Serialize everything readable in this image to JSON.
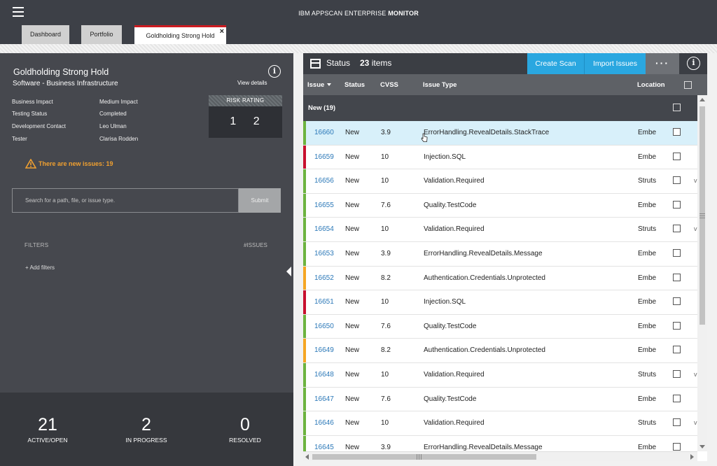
{
  "header": {
    "app_title_prefix": "IBM APPSCAN ENTERPRISE",
    "app_title_suffix": "MONITOR",
    "tabs": [
      {
        "label": "Dashboard"
      },
      {
        "label": "Portfolio"
      },
      {
        "label": "Goldholding Strong Hold",
        "close": "×"
      }
    ]
  },
  "app": {
    "name": "Goldholding Strong Hold",
    "subtitle": "Software - Business Infrastructure",
    "view_details": "View details",
    "properties": [
      {
        "key": "Business Impact",
        "value": "Medium Impact"
      },
      {
        "key": "Testing Status",
        "value": "Completed"
      },
      {
        "key": "Development Contact",
        "value": "Leo Ulman"
      },
      {
        "key": "Tester",
        "value": "Clarisa Rodden"
      }
    ],
    "risk_label": "RISK RATING",
    "risk_value": "1 2",
    "warning": "There are new issues: 19"
  },
  "search": {
    "placeholder": "Search for a path, file, or issue type.",
    "submit_label": "Submit"
  },
  "filters": {
    "heading": "FILTERS",
    "issues_heading": "#ISSUES",
    "add_label": "+ Add filters"
  },
  "stats": [
    {
      "value": "21",
      "label": "ACTIVE/OPEN"
    },
    {
      "value": "2",
      "label": "IN PROGRESS"
    },
    {
      "value": "0",
      "label": "RESOLVED"
    }
  ],
  "status_panel": {
    "title": "Status",
    "count": "23",
    "count_suffix": "items",
    "create_label": "Create Scan",
    "import_label": "Import Issues",
    "more_label": "···",
    "columns": {
      "issue": "Issue",
      "status": "Status",
      "cvss": "CVSS",
      "type": "Issue Type",
      "location": "Location"
    },
    "group_label": "New (19)"
  },
  "severity_colors": {
    "low": "#6db33f",
    "high": "#c8102e",
    "medium": "#f5a623"
  },
  "issues": [
    {
      "id": "16660",
      "status": "New",
      "cvss": "3.9",
      "type": "ErrorHandling.RevealDetails.StackTrace",
      "location": "Embe",
      "trail": "",
      "severity": "low",
      "selected": true
    },
    {
      "id": "16659",
      "status": "New",
      "cvss": "10",
      "type": "Injection.SQL",
      "location": "Embe",
      "trail": "",
      "severity": "high"
    },
    {
      "id": "16656",
      "status": "New",
      "cvss": "10",
      "type": "Validation.Required",
      "location": "Struts",
      "trail": "v",
      "severity": "low"
    },
    {
      "id": "16655",
      "status": "New",
      "cvss": "7.6",
      "type": "Quality.TestCode",
      "location": "Embe",
      "trail": "",
      "severity": "low"
    },
    {
      "id": "16654",
      "status": "New",
      "cvss": "10",
      "type": "Validation.Required",
      "location": "Struts",
      "trail": "v",
      "severity": "low"
    },
    {
      "id": "16653",
      "status": "New",
      "cvss": "3.9",
      "type": "ErrorHandling.RevealDetails.Message",
      "location": "Embe",
      "trail": "",
      "severity": "low"
    },
    {
      "id": "16652",
      "status": "New",
      "cvss": "8.2",
      "type": "Authentication.Credentials.Unprotected",
      "location": "Embe",
      "trail": "",
      "severity": "medium"
    },
    {
      "id": "16651",
      "status": "New",
      "cvss": "10",
      "type": "Injection.SQL",
      "location": "Embe",
      "trail": "",
      "severity": "high"
    },
    {
      "id": "16650",
      "status": "New",
      "cvss": "7.6",
      "type": "Quality.TestCode",
      "location": "Embe",
      "trail": "",
      "severity": "low"
    },
    {
      "id": "16649",
      "status": "New",
      "cvss": "8.2",
      "type": "Authentication.Credentials.Unprotected",
      "location": "Embe",
      "trail": "",
      "severity": "medium"
    },
    {
      "id": "16648",
      "status": "New",
      "cvss": "10",
      "type": "Validation.Required",
      "location": "Struts",
      "trail": "v",
      "severity": "low"
    },
    {
      "id": "16647",
      "status": "New",
      "cvss": "7.6",
      "type": "Quality.TestCode",
      "location": "Embe",
      "trail": "",
      "severity": "low"
    },
    {
      "id": "16646",
      "status": "New",
      "cvss": "10",
      "type": "Validation.Required",
      "location": "Struts",
      "trail": "v",
      "severity": "low"
    },
    {
      "id": "16645",
      "status": "New",
      "cvss": "3.9",
      "type": "ErrorHandling.RevealDetails.Message",
      "location": "Embe",
      "trail": "",
      "severity": "low"
    }
  ]
}
